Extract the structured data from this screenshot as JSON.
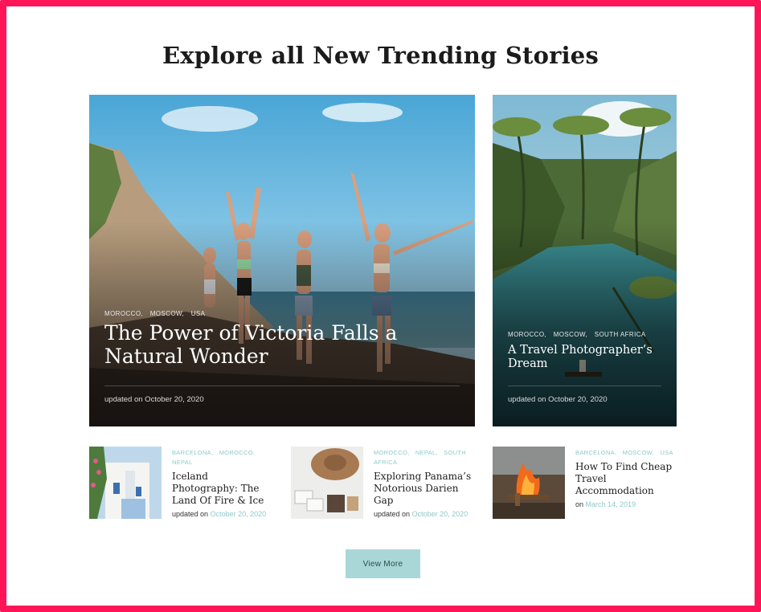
{
  "section_title": "Explore all New Trending Stories",
  "featured": [
    {
      "tags": [
        "Morocco,",
        "Moscow,",
        "USA"
      ],
      "title": "The Power of Victoria Falls a Natural Wonder",
      "date": "updated on October 20, 2020"
    },
    {
      "tags": [
        "Morocco,",
        "Moscow,",
        "South Africa"
      ],
      "title": "A Travel Photographer’s Dream",
      "date": "updated on October 20, 2020"
    }
  ],
  "stories": [
    {
      "tags": [
        "Barcelona,",
        "Morocco,",
        "Nepal"
      ],
      "title": "Iceland Photography: The Land Of Fire & Ice",
      "meta_prefix": "updated on",
      "date": "October 20, 2020"
    },
    {
      "tags": [
        "Morocco,",
        "Nepal,",
        "South Africa"
      ],
      "title": "Exploring Panama’s Notorious Darien Gap",
      "meta_prefix": "updated on",
      "date": "October 20, 2020"
    },
    {
      "tags": [
        "Barcelona,",
        "Moscow,",
        "USA"
      ],
      "title": "How To Find Cheap Travel Accommodation",
      "meta_prefix": "on",
      "date": "March 14, 2019"
    }
  ],
  "view_more_label": "View More",
  "colors": {
    "frame": "#ff1457",
    "accent": "#a9d7d7",
    "tag": "#8ec9c9"
  }
}
